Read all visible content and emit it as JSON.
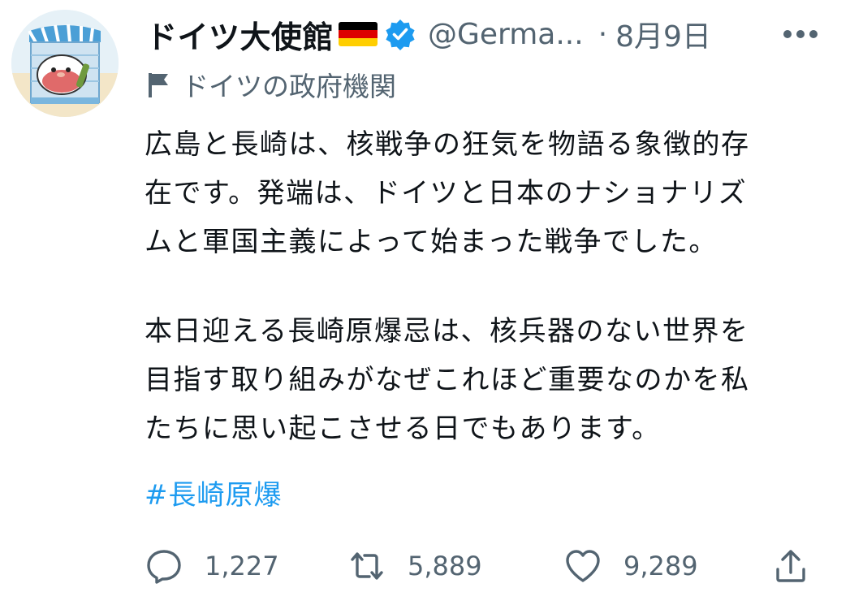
{
  "tweet": {
    "author": {
      "display_name": "ドイツ大使館",
      "handle": "@Germa...",
      "verified": true,
      "label": "ドイツの政府機関"
    },
    "separator": "·",
    "date": "8月9日",
    "text_lines": [
      "広島と長崎は、核戦争の狂気を物語る象徴的存",
      "在です。発端は、ドイツと日本のナショナリズ",
      "ムと軍国主義によって始まった戦争でした。",
      "本日迎える長崎原爆忌は、核兵器のない世界を",
      "目指す取り組みがなぜこれほど重要なのかを私",
      "たちに思い起こさせる日でもあります。"
    ],
    "hashtag": "#長崎原爆",
    "stats": {
      "replies": "1,227",
      "retweets": "5,889",
      "likes": "9,289"
    }
  },
  "colors": {
    "text": "#0f1419",
    "secondary": "#536471",
    "link": "#1d9bf0",
    "verified": "#1d9bf0"
  },
  "icons": {
    "more": "more-horizontal-icon",
    "gov_label": "government-flag-icon",
    "reply": "reply-icon",
    "retweet": "retweet-icon",
    "like": "heart-icon",
    "share": "share-icon"
  }
}
